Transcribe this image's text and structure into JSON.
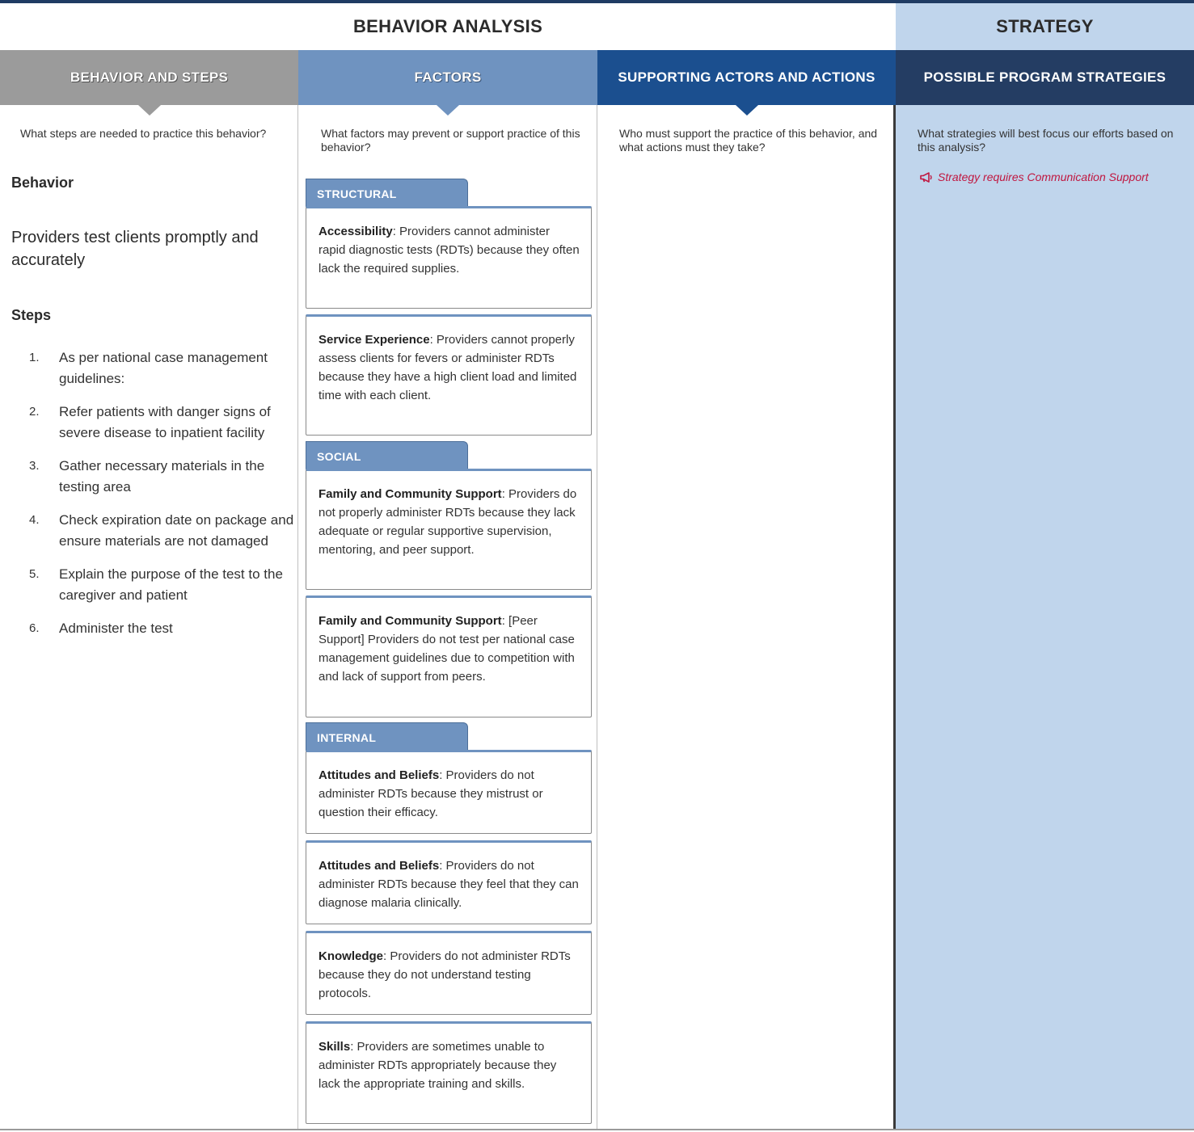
{
  "sections": {
    "analysis": "BEHAVIOR ANALYSIS",
    "strategy": "STRATEGY"
  },
  "columns": {
    "behavior": {
      "title": "BEHAVIOR AND STEPS",
      "prompt": "What steps are needed to practice this behavior?",
      "behavior_label": "Behavior",
      "behavior_text": "Providers test clients promptly and accurately",
      "steps_label": "Steps",
      "steps": [
        {
          "num": "1.",
          "text": "As per national case management guidelines:"
        },
        {
          "num": "2.",
          "text": "Refer patients with danger signs of severe disease to inpatient facility"
        },
        {
          "num": "3.",
          "text": "Gather necessary materials in the testing area"
        },
        {
          "num": "4.",
          "text": "Check expiration date on package and ensure materials are not damaged"
        },
        {
          "num": "5.",
          "text": "Explain the purpose of the test to the caregiver and patient"
        },
        {
          "num": "6.",
          "text": "Administer the test"
        }
      ]
    },
    "factors": {
      "title": "FACTORS",
      "prompt": "What factors may prevent or support practice of this behavior?",
      "categories": {
        "structural": "STRUCTURAL",
        "social": "SOCIAL",
        "internal": "INTERNAL"
      },
      "cards": [
        {
          "name": "Accessibility",
          "text": ": Providers cannot administer rapid diagnostic tests (RDTs) because they often lack the required supplies."
        },
        {
          "name": "Service Experience",
          "text": ": Providers cannot properly assess clients for fevers or administer RDTs because they have a high client load and limited time with each client."
        },
        {
          "name": "Family and Community Support",
          "text": ": Providers do not properly administer RDTs because they lack adequate or regular supportive supervision, mentoring, and peer support."
        },
        {
          "name": "Family and Community Support",
          "text": ": [Peer Support] Providers do not test per national case management guidelines due to competition with and lack of support from peers."
        },
        {
          "name": "Attitudes and Beliefs",
          "text": ": Providers do not administer RDTs because they mistrust or question their efficacy."
        },
        {
          "name": "Attitudes and Beliefs",
          "text": ": Providers do not administer RDTs because they feel that they can diagnose malaria clinically."
        },
        {
          "name": "Knowledge",
          "text": ": Providers do not administer RDTs because they do not understand testing protocols."
        },
        {
          "name": "Skills",
          "text": ": Providers are sometimes unable to administer RDTs appropriately because they lack the appropriate training and skills."
        }
      ]
    },
    "actors": {
      "title": "SUPPORTING ACTORS AND ACTIONS",
      "prompt": "Who must support the practice of this behavior, and what actions must they take?"
    },
    "strategies": {
      "title": "POSSIBLE PROGRAM STRATEGIES",
      "prompt": "What strategies will best focus our efforts based on this analysis?",
      "comm_support": "Strategy requires Communication Support"
    }
  },
  "icons": {
    "comm_support": "megaphone-icon"
  },
  "colors": {
    "behavior_header": "#9b9b9b",
    "factors_header": "#6f93c0",
    "actors_header": "#1b4f8f",
    "strategies_header": "#243d63",
    "strategy_bg": "#c0d5ec",
    "comm_support_text": "#c0163f"
  }
}
